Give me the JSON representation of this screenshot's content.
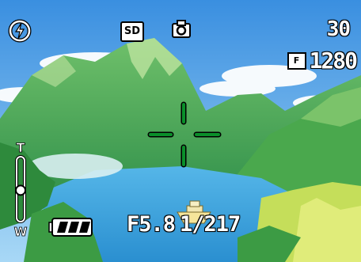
{
  "icons": {
    "flash": "flash-off-icon",
    "camera": "camera-mode-icon",
    "quality": "fine-quality-icon",
    "battery": "battery-icon",
    "focus": "focus-frame-icon"
  },
  "status": {
    "sd_label": "SD",
    "shots_remaining": "30",
    "quality_label": "F",
    "resolution": "1280",
    "aperture": "F5.8",
    "shutter": "1/217"
  },
  "zoom": {
    "tele_label": "T",
    "wide_label": "W",
    "level": 0.48
  },
  "battery": {
    "level": 1.0
  },
  "colors": {
    "focus": "#0a8f2a",
    "overlay_text": "#ffffff"
  }
}
